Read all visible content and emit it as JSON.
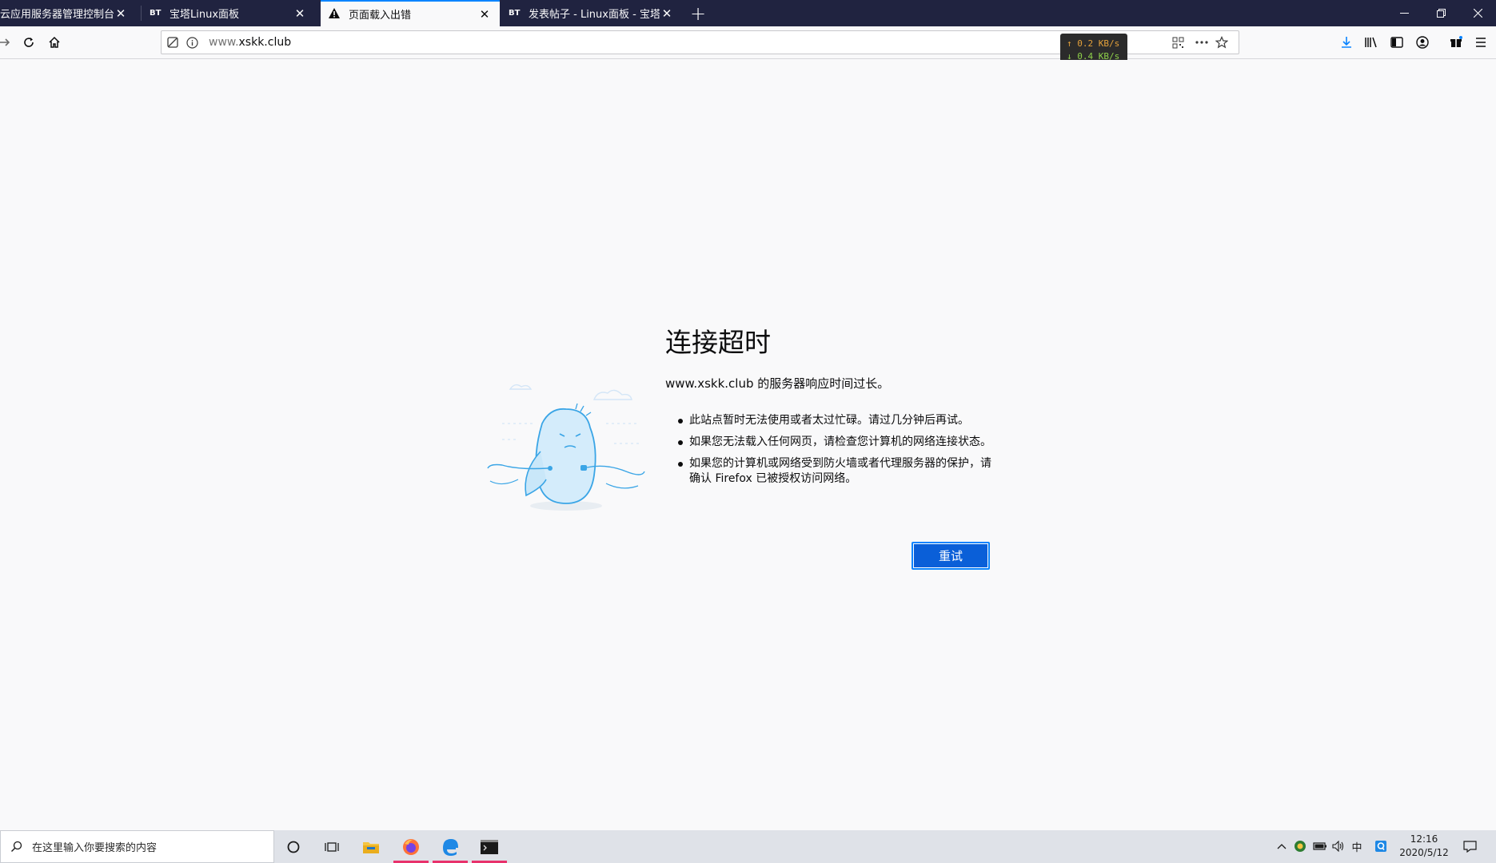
{
  "tabs": [
    {
      "label": "云应用服务器管理控制台",
      "favicon": "",
      "active": false
    },
    {
      "label": "宝塔Linux面板",
      "favicon": "BT",
      "active": false
    },
    {
      "label": "页面载入出错",
      "favicon": "warning-icon",
      "active": true
    },
    {
      "label": "发表帖子 - Linux面板 - 宝塔面",
      "favicon": "BT",
      "active": false
    }
  ],
  "navbar": {
    "url_dim": "www.",
    "url_main": "xskk.club"
  },
  "speed": {
    "up": "↑ 0.2 KB/s",
    "down": "↓ 0.4 KB/s"
  },
  "error": {
    "title": "连接超时",
    "description": "www.xskk.club 的服务器响应时间过长。",
    "bullets": [
      "此站点暂时无法使用或者太过忙碌。请过几分钟后再试。",
      "如果您无法载入任何网页，请检查您计算机的网络连接状态。",
      "如果您的计算机或网络受到防火墙或者代理服务器的保护，请确认 Firefox 已被授权访问网络。"
    ],
    "retry_label": "重试"
  },
  "taskbar": {
    "search_placeholder": "在这里输入你要搜索的内容",
    "ime_label": "中",
    "time": "12:16",
    "date": "2020/5/12"
  },
  "colors": {
    "tabbar_bg": "#202340",
    "accent": "#0a84ff",
    "retry_bg": "#0a5fd8",
    "taskbar_running": "#e8316b"
  }
}
